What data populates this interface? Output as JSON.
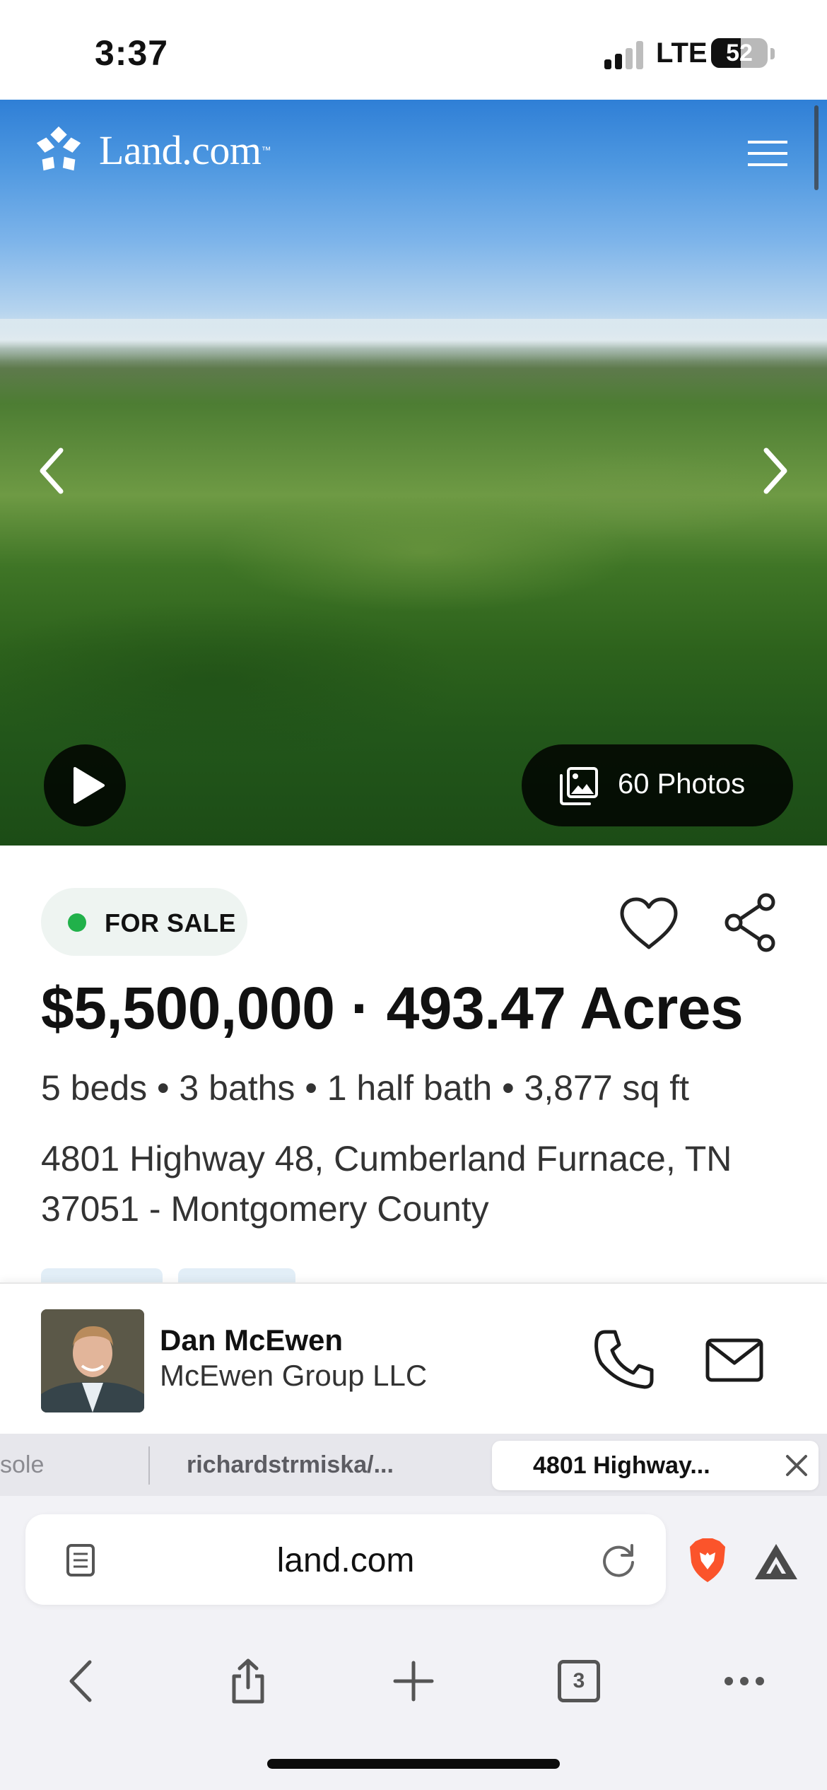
{
  "status_bar": {
    "time": "3:37",
    "network": "LTE",
    "battery": "52",
    "battery_level_percent": 52
  },
  "site": {
    "logo_text": "Land.com",
    "trademark": "™"
  },
  "hero": {
    "photos_label": "60 Photos"
  },
  "listing": {
    "status": "FOR SALE",
    "status_color": "#21b14a",
    "price": "$5,500,000",
    "separator": "·",
    "acreage": "493.47 Acres",
    "specs": "5 beds • 3 baths • 1 half bath • 3,877 sq ft",
    "address_line1": "4801 Highway 48, Cumberland Furnace, TN",
    "address_line2": "37051 - Montgomery County"
  },
  "agent": {
    "name": "Dan McEwen",
    "company": "McEwen Group LLC"
  },
  "tabs": [
    {
      "label": "sole"
    },
    {
      "label": "richardstrmiska/..."
    },
    {
      "label": "4801 Highway...",
      "active": true
    }
  ],
  "browser": {
    "url": "land.com",
    "tab_count": "3",
    "brand_color": "#fb542b"
  },
  "icons": {
    "logo": "land-logo-icon",
    "menu": "hamburger-icon",
    "prev": "chevron-left-icon",
    "next": "chevron-right-icon",
    "play": "play-icon",
    "photos": "photo-gallery-icon",
    "favorite": "heart-icon",
    "share": "share-icon",
    "phone": "phone-icon",
    "mail": "mail-icon",
    "close": "close-icon",
    "reader": "reader-icon",
    "reload": "reload-icon",
    "brave": "brave-lion-icon",
    "rewards": "rewards-triangle-icon",
    "back": "back-icon",
    "share_page": "share-page-icon",
    "new_tab": "plus-icon",
    "tabs": "tabs-icon",
    "more": "more-icon"
  }
}
